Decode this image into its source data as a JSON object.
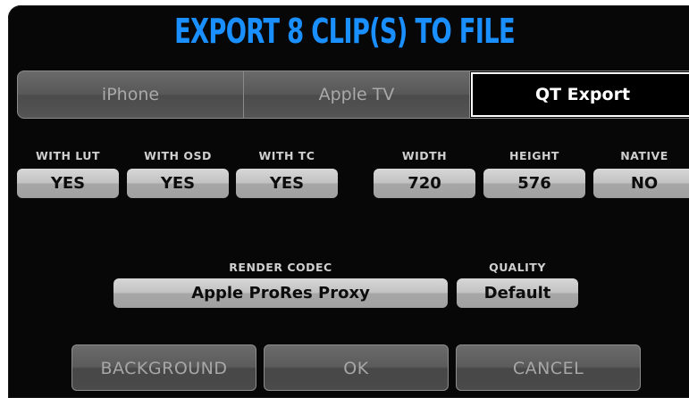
{
  "dialog": {
    "title": "EXPORT 8 CLIP(S) TO FILE"
  },
  "tabs": [
    {
      "label": "iPhone",
      "selected": false
    },
    {
      "label": "Apple TV",
      "selected": false
    },
    {
      "label": "QT Export",
      "selected": true
    }
  ],
  "options": {
    "with_lut": {
      "label": "WITH LUT",
      "value": "YES"
    },
    "with_osd": {
      "label": "WITH OSD",
      "value": "YES"
    },
    "with_tc": {
      "label": "WITH TC",
      "value": "YES"
    },
    "width": {
      "label": "WIDTH",
      "value": "720"
    },
    "height": {
      "label": "HEIGHT",
      "value": "576"
    },
    "native": {
      "label": "NATIVE",
      "value": "NO"
    },
    "render_codec": {
      "label": "RENDER CODEC",
      "value": "Apple ProRes Proxy"
    },
    "quality": {
      "label": "QUALITY",
      "value": "Default"
    }
  },
  "buttons": {
    "background": "BACKGROUND",
    "ok": "OK",
    "cancel": "CANCEL"
  },
  "colors": {
    "title": "#1a8fff",
    "dialog_bg": "#070707",
    "field_bg": "#c2c2c2",
    "tab_selected_bg": "#000000"
  }
}
